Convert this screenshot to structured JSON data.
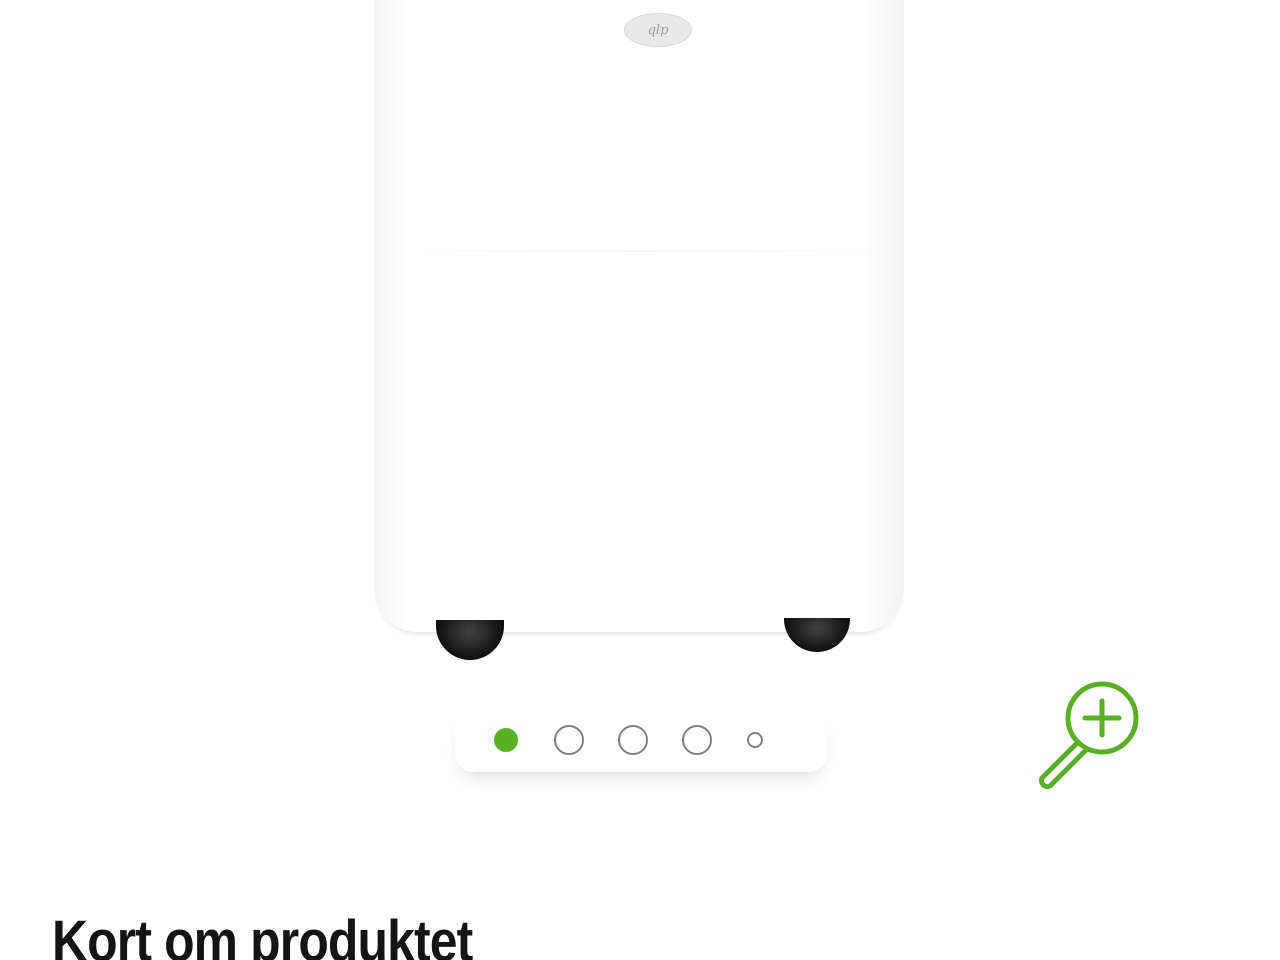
{
  "product_image": {
    "brand_badge_text": "qlp",
    "alt": ""
  },
  "carousel": {
    "dots": [
      {
        "label": "slide-1",
        "active": true
      },
      {
        "label": "slide-2",
        "active": false
      },
      {
        "label": "slide-3",
        "active": false
      },
      {
        "label": "slide-4",
        "active": false
      },
      {
        "label": "slide-5",
        "active": false
      }
    ],
    "active_color": "#5ab025",
    "inactive_color": "#808080"
  },
  "zoom": {
    "icon": "zoom-in-icon",
    "color": "#5ab025"
  },
  "section": {
    "title": "Kort om produktet"
  }
}
